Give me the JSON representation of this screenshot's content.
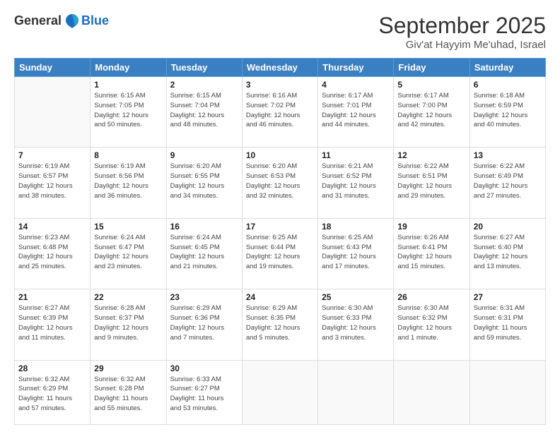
{
  "logo": {
    "general": "General",
    "blue": "Blue"
  },
  "header": {
    "month": "September 2025",
    "location": "Giv'at Hayyim Me'uhad, Israel"
  },
  "days_of_week": [
    "Sunday",
    "Monday",
    "Tuesday",
    "Wednesday",
    "Thursday",
    "Friday",
    "Saturday"
  ],
  "weeks": [
    [
      {
        "day": "",
        "info": ""
      },
      {
        "day": "1",
        "info": "Sunrise: 6:15 AM\nSunset: 7:05 PM\nDaylight: 12 hours\nand 50 minutes."
      },
      {
        "day": "2",
        "info": "Sunrise: 6:15 AM\nSunset: 7:04 PM\nDaylight: 12 hours\nand 48 minutes."
      },
      {
        "day": "3",
        "info": "Sunrise: 6:16 AM\nSunset: 7:02 PM\nDaylight: 12 hours\nand 46 minutes."
      },
      {
        "day": "4",
        "info": "Sunrise: 6:17 AM\nSunset: 7:01 PM\nDaylight: 12 hours\nand 44 minutes."
      },
      {
        "day": "5",
        "info": "Sunrise: 6:17 AM\nSunset: 7:00 PM\nDaylight: 12 hours\nand 42 minutes."
      },
      {
        "day": "6",
        "info": "Sunrise: 6:18 AM\nSunset: 6:59 PM\nDaylight: 12 hours\nand 40 minutes."
      }
    ],
    [
      {
        "day": "7",
        "info": "Sunrise: 6:19 AM\nSunset: 6:57 PM\nDaylight: 12 hours\nand 38 minutes."
      },
      {
        "day": "8",
        "info": "Sunrise: 6:19 AM\nSunset: 6:56 PM\nDaylight: 12 hours\nand 36 minutes."
      },
      {
        "day": "9",
        "info": "Sunrise: 6:20 AM\nSunset: 6:55 PM\nDaylight: 12 hours\nand 34 minutes."
      },
      {
        "day": "10",
        "info": "Sunrise: 6:20 AM\nSunset: 6:53 PM\nDaylight: 12 hours\nand 32 minutes."
      },
      {
        "day": "11",
        "info": "Sunrise: 6:21 AM\nSunset: 6:52 PM\nDaylight: 12 hours\nand 31 minutes."
      },
      {
        "day": "12",
        "info": "Sunrise: 6:22 AM\nSunset: 6:51 PM\nDaylight: 12 hours\nand 29 minutes."
      },
      {
        "day": "13",
        "info": "Sunrise: 6:22 AM\nSunset: 6:49 PM\nDaylight: 12 hours\nand 27 minutes."
      }
    ],
    [
      {
        "day": "14",
        "info": "Sunrise: 6:23 AM\nSunset: 6:48 PM\nDaylight: 12 hours\nand 25 minutes."
      },
      {
        "day": "15",
        "info": "Sunrise: 6:24 AM\nSunset: 6:47 PM\nDaylight: 12 hours\nand 23 minutes."
      },
      {
        "day": "16",
        "info": "Sunrise: 6:24 AM\nSunset: 6:45 PM\nDaylight: 12 hours\nand 21 minutes."
      },
      {
        "day": "17",
        "info": "Sunrise: 6:25 AM\nSunset: 6:44 PM\nDaylight: 12 hours\nand 19 minutes."
      },
      {
        "day": "18",
        "info": "Sunrise: 6:25 AM\nSunset: 6:43 PM\nDaylight: 12 hours\nand 17 minutes."
      },
      {
        "day": "19",
        "info": "Sunrise: 6:26 AM\nSunset: 6:41 PM\nDaylight: 12 hours\nand 15 minutes."
      },
      {
        "day": "20",
        "info": "Sunrise: 6:27 AM\nSunset: 6:40 PM\nDaylight: 12 hours\nand 13 minutes."
      }
    ],
    [
      {
        "day": "21",
        "info": "Sunrise: 6:27 AM\nSunset: 6:39 PM\nDaylight: 12 hours\nand 11 minutes."
      },
      {
        "day": "22",
        "info": "Sunrise: 6:28 AM\nSunset: 6:37 PM\nDaylight: 12 hours\nand 9 minutes."
      },
      {
        "day": "23",
        "info": "Sunrise: 6:29 AM\nSunset: 6:36 PM\nDaylight: 12 hours\nand 7 minutes."
      },
      {
        "day": "24",
        "info": "Sunrise: 6:29 AM\nSunset: 6:35 PM\nDaylight: 12 hours\nand 5 minutes."
      },
      {
        "day": "25",
        "info": "Sunrise: 6:30 AM\nSunset: 6:33 PM\nDaylight: 12 hours\nand 3 minutes."
      },
      {
        "day": "26",
        "info": "Sunrise: 6:30 AM\nSunset: 6:32 PM\nDaylight: 12 hours\nand 1 minute."
      },
      {
        "day": "27",
        "info": "Sunrise: 6:31 AM\nSunset: 6:31 PM\nDaylight: 11 hours\nand 59 minutes."
      }
    ],
    [
      {
        "day": "28",
        "info": "Sunrise: 6:32 AM\nSunset: 6:29 PM\nDaylight: 11 hours\nand 57 minutes."
      },
      {
        "day": "29",
        "info": "Sunrise: 6:32 AM\nSunset: 6:28 PM\nDaylight: 11 hours\nand 55 minutes."
      },
      {
        "day": "30",
        "info": "Sunrise: 6:33 AM\nSunset: 6:27 PM\nDaylight: 11 hours\nand 53 minutes."
      },
      {
        "day": "",
        "info": ""
      },
      {
        "day": "",
        "info": ""
      },
      {
        "day": "",
        "info": ""
      },
      {
        "day": "",
        "info": ""
      }
    ]
  ]
}
